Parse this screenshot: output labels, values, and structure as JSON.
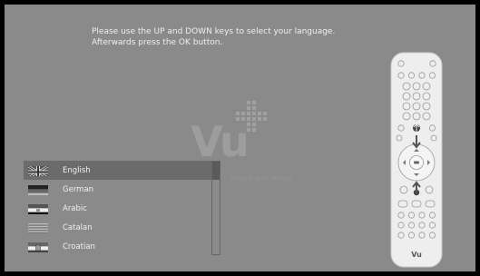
{
  "instructions": {
    "line1": "Please use the UP and DOWN keys to select your language.",
    "line2": "Afterwards press the OK button."
  },
  "logo": {
    "text": "Vu",
    "tagline": "Smart and Yellow",
    "remote_brand": "Vu"
  },
  "languages": [
    {
      "label": "English",
      "flag": "uk-flag-icon",
      "selected": true
    },
    {
      "label": "German",
      "flag": "german-flag-icon",
      "selected": false
    },
    {
      "label": "Arabic",
      "flag": "arabic-flag-icon",
      "selected": false
    },
    {
      "label": "Catalan",
      "flag": "catalan-flag-icon",
      "selected": false
    },
    {
      "label": "Croatian",
      "flag": "croatian-flag-icon",
      "selected": false
    }
  ],
  "colors": {
    "background": "#8a8a8a",
    "selection": "#6b6b6b",
    "text": "#efefef"
  }
}
